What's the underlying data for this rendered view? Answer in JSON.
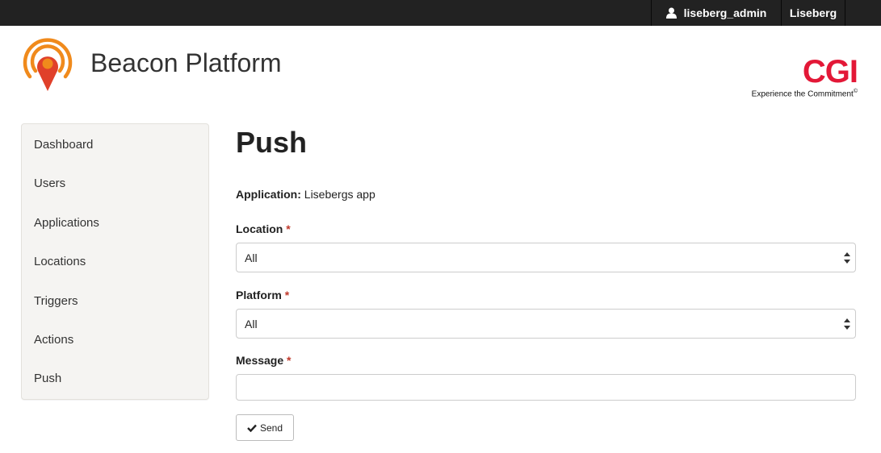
{
  "topbar": {
    "username": "liseberg_admin",
    "org": "Liseberg"
  },
  "brand": {
    "name": "Beacon Platform"
  },
  "cgi": {
    "mark": "CGI",
    "tagline": "Experience the Commitment",
    "tag_symbol": "©"
  },
  "sidebar": {
    "items": [
      {
        "label": "Dashboard"
      },
      {
        "label": "Users"
      },
      {
        "label": "Applications"
      },
      {
        "label": "Locations"
      },
      {
        "label": "Triggers"
      },
      {
        "label": "Actions"
      },
      {
        "label": "Push"
      }
    ]
  },
  "page": {
    "title": "Push",
    "application_label": "Application:",
    "application_value": "Lisebergs app"
  },
  "form": {
    "required_mark": "*",
    "location": {
      "label": "Location",
      "value": "All"
    },
    "platform": {
      "label": "Platform",
      "value": "All"
    },
    "message": {
      "label": "Message",
      "value": "",
      "placeholder": ""
    },
    "send_label": "Send"
  },
  "colors": {
    "topbar": "#222222",
    "brand_red": "#e31837",
    "logo_orange": "#f08a1c",
    "logo_red": "#e0402a",
    "required": "#c0392b"
  },
  "icons": {
    "user": "user-icon",
    "check": "check-icon",
    "select_arrows": "select-arrows-icon"
  }
}
